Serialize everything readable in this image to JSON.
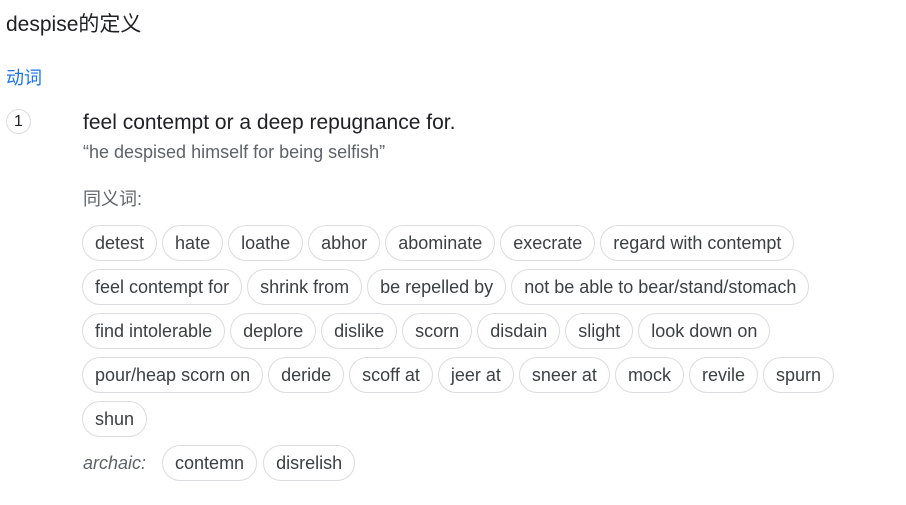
{
  "entry": {
    "title": "despise的定义",
    "part_of_speech": "动词"
  },
  "sense": {
    "number": "1",
    "definition": "feel contempt or a deep repugnance for.",
    "example": "“he despised himself for being selfish”"
  },
  "synonyms": {
    "label": "同义词:",
    "items": [
      "detest",
      "hate",
      "loathe",
      "abhor",
      "abominate",
      "execrate",
      "regard with contempt",
      "feel contempt for",
      "shrink from",
      "be repelled by",
      "not be able to bear/stand/stomach",
      "find intolerable",
      "deplore",
      "dislike",
      "scorn",
      "disdain",
      "slight",
      "look down on",
      "pour/heap scorn on",
      "deride",
      "scoff at",
      "jeer at",
      "sneer at",
      "mock",
      "revile",
      "spurn",
      "shun"
    ]
  },
  "archaic": {
    "label": "archaic:",
    "items": [
      "contemn",
      "disrelish"
    ]
  }
}
